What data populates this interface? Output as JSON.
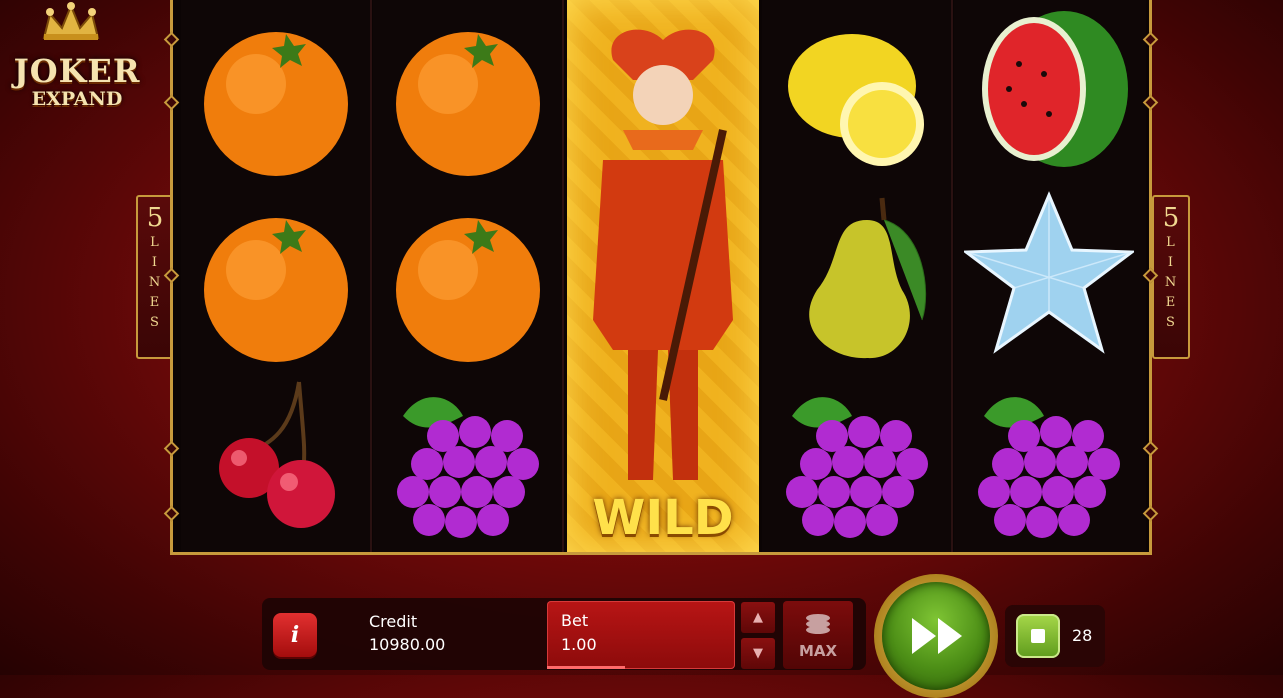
{
  "logo": {
    "line1": "JOKER",
    "line2": "EXPAND"
  },
  "paylines": {
    "left_number": "5",
    "left_word": "LINES",
    "right_number": "5",
    "right_word": "LINES"
  },
  "reels": [
    {
      "symbols": [
        "orange",
        "orange",
        "cherry"
      ]
    },
    {
      "symbols": [
        "orange",
        "orange",
        "grapes"
      ]
    },
    {
      "symbols": [
        "joker-wild"
      ]
    },
    {
      "symbols": [
        "lemon",
        "pear",
        "grapes"
      ]
    },
    {
      "symbols": [
        "watermelon",
        "star",
        "grapes"
      ]
    }
  ],
  "wild_label": "WILD",
  "controls": {
    "info_label": "i",
    "credit_label": "Credit",
    "credit_value": "10980.00",
    "bet_label": "Bet",
    "bet_value": "1.00",
    "bet_up_icon": "▲",
    "bet_down_icon": "▼",
    "max_label": "MAX",
    "autoplay_count": "28"
  },
  "colors": {
    "background": "#8a0f0f",
    "frame_gold": "#c79a3c",
    "spin_green": "#4c8e16",
    "bet_red": "#b81515"
  }
}
